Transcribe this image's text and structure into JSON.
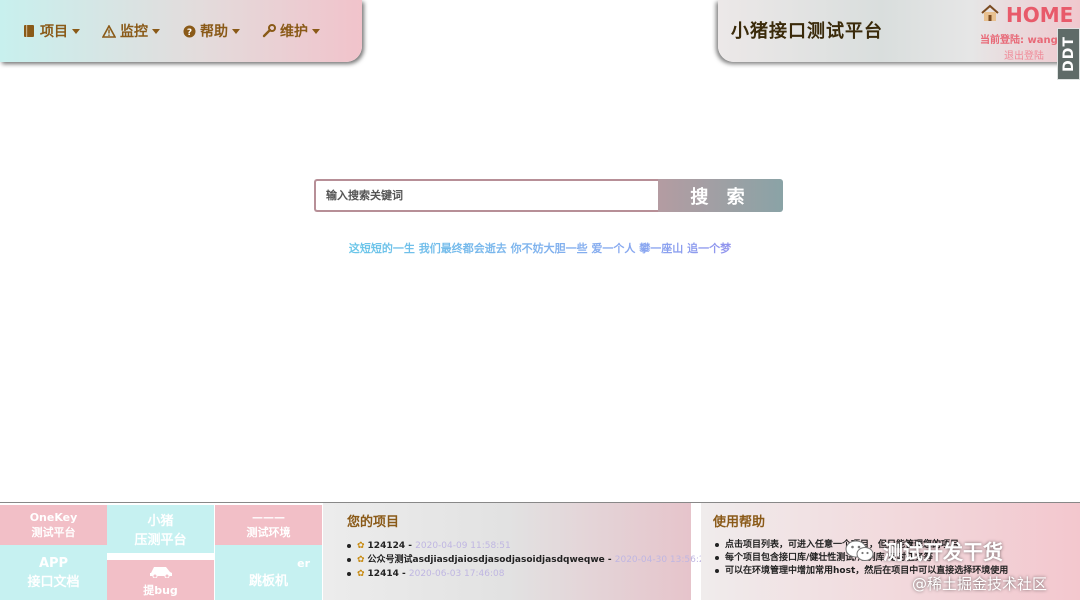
{
  "nav": {
    "items": [
      {
        "label": "项目",
        "icon": "book-icon"
      },
      {
        "label": "监控",
        "icon": "warning-icon"
      },
      {
        "label": "帮助",
        "icon": "question-icon"
      },
      {
        "label": "维护",
        "icon": "wrench-icon"
      }
    ]
  },
  "header": {
    "title": "小猪接口测试平台",
    "home_label": "HOME",
    "login_text": "当前登陆: wang",
    "logout_label": "退出登陆",
    "badge": "DDT"
  },
  "search": {
    "placeholder": "输入搜索关键词",
    "value": "",
    "button_label": "搜 索"
  },
  "slogan": "这短短的一生 我们最终都会逝去 你不妨大胆一些 爱一个人 攀一座山 追一个梦",
  "footer": {
    "tiles": [
      {
        "line1": "OneKey",
        "line2": "测试平台"
      },
      {
        "line1": "小猪",
        "line2": "压测平台"
      },
      {
        "line1": "———",
        "line2": "测试环境"
      },
      {
        "line1": "APP",
        "line2": "接口文档"
      },
      {
        "line1": "",
        "line2": "提bug"
      },
      {
        "line1": "er",
        "line2": "跳板机"
      }
    ],
    "projects": {
      "title": "您的项目",
      "items": [
        {
          "name": "124124",
          "sep": " - ",
          "time": "2020-04-09 11:58:51"
        },
        {
          "name": "公众号测试asdjiasdjaiosdjasodjasoidjasdqweqwe",
          "sep": " - ",
          "time": "2020-04-30 13:56:26"
        },
        {
          "name": "12414",
          "sep": " - ",
          "time": "2020-06-03 17:46:08"
        }
      ]
    },
    "help": {
      "title": "使用帮助",
      "items": [
        "点击项目列表，可进入任意一个项目，但只能管理您的项目",
        "每个项目包含接口库/健壮性测试/用例库/定时任务等",
        "可以在环境管理中增加常用host，然后在项目中可以直接选择环境使用"
      ]
    }
  },
  "watermark": {
    "main": "测试开发干货",
    "sub": "@稀土掘金技术社区"
  },
  "colors": {
    "nav_text": "#8a5a18",
    "home": "#e85a6a",
    "tile_pink": "#f2bfc7",
    "tile_cyan": "#c6f1f1"
  }
}
